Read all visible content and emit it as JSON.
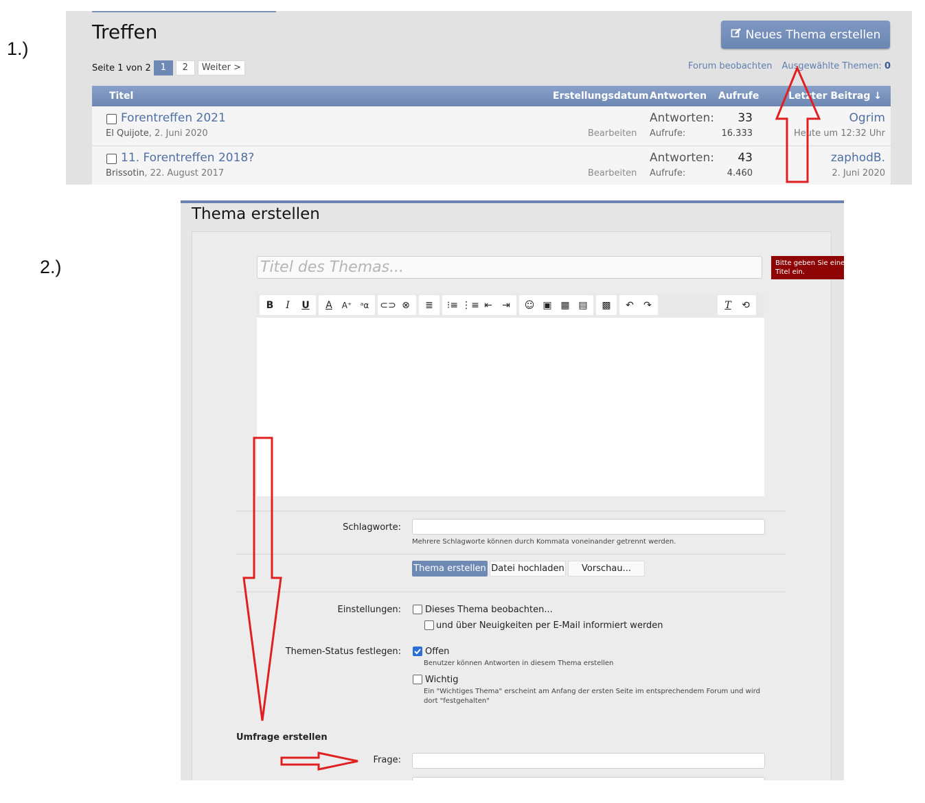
{
  "labels": {
    "step1": "1.)",
    "step2": "2.)"
  },
  "forum": {
    "title": "Treffen",
    "new_thread_button": "Neues Thema erstellen",
    "pagination": {
      "prefix": "Seite 1 von 2",
      "pages": [
        "1",
        "2"
      ],
      "current": "1",
      "next": "Weiter >"
    },
    "watch_link": "Forum beobachten",
    "selected_label": "Ausgewählte Themen:",
    "selected_count": "0",
    "columns": {
      "title": "Titel",
      "created": "Erstellungsdatum",
      "replies": "Antworten",
      "views": "Aufrufe",
      "last_post": "Letzter Beitrag ↓"
    },
    "threads": [
      {
        "title": "Forentreffen 2021",
        "author": "El Quijote",
        "date": "2. Juni 2020",
        "edit": "Bearbeiten",
        "replies_label": "Antworten:",
        "replies": "33",
        "views_label": "Aufrufe:",
        "views": "16.333",
        "last_user": "Ogrim",
        "last_date": "Heute um 12:32 Uhr"
      },
      {
        "title": "11. Forentreffen 2018?",
        "author": "Brissotin",
        "date": "22. August 2017",
        "edit": "Bearbeiten",
        "replies_label": "Antworten:",
        "replies": "43",
        "views_label": "Aufrufe:",
        "views": "4.460",
        "last_user": "zaphodB.",
        "last_date": "2. Juni 2020"
      }
    ]
  },
  "create": {
    "heading": "Thema erstellen",
    "title_placeholder": "Titel des Themas...",
    "error_tooltip": "Bitte geben Sie einen Titel ein.",
    "tags_label": "Schlagworte:",
    "tags_hint": "Mehrere Schlagworte können durch Kommata voneinander getrennt werden.",
    "buttons": {
      "submit": "Thema erstellen",
      "upload": "Datei hochladen",
      "preview": "Vorschau..."
    },
    "settings_label": "Einstellungen:",
    "watch_option": "Dieses Thema beobachten...",
    "email_option": "und über Neuigkeiten per E-Mail informiert werden",
    "status_label": "Themen-Status festlegen:",
    "open_option": "Offen",
    "open_hint": "Benutzer können Antworten in diesem Thema erstellen",
    "sticky_option": "Wichtig",
    "sticky_hint_1": "Ein \"Wichtiges Thema\" erscheint am Anfang der ersten Seite im entsprechendem Forum und wird",
    "sticky_hint_2": "dort \"festgehalten\"",
    "poll_section": "Umfrage erstellen",
    "question_label": "Frage:"
  },
  "toolbar_icons": [
    "bold-icon",
    "italic-icon",
    "underline-icon",
    "font-color-icon",
    "font-size-icon",
    "font-family-icon",
    "link-icon",
    "unlink-icon",
    "align-icon",
    "bullet-list-icon",
    "numbered-list-icon",
    "outdent-icon",
    "indent-icon",
    "smilie-icon",
    "image-icon",
    "media-icon",
    "quote-icon",
    "save-draft-icon",
    "undo-icon",
    "redo-icon",
    "remove-format-icon",
    "toggle-bbcode-icon"
  ],
  "colors": {
    "accent": "#6f89b5",
    "link": "#4e6fa3",
    "error": "#8e0404",
    "annotation": "#e02020"
  }
}
